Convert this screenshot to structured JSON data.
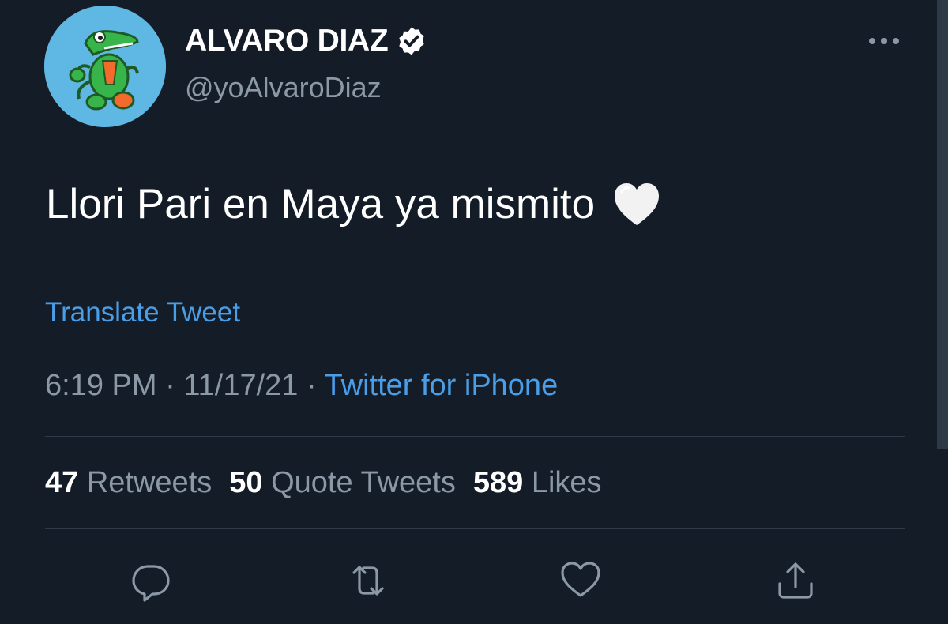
{
  "user": {
    "display_name": "ALVARO DIAZ",
    "handle": "@yoAlvaroDiaz",
    "verified": true,
    "avatar_icon": "green-crocodile-avatar"
  },
  "tweet": {
    "text": "Llori Pari en Maya ya mismito",
    "emoji": "white-heart",
    "translate_label": "Translate Tweet",
    "time": "6:19 PM",
    "separator": " · ",
    "date": "11/17/21",
    "source": "Twitter for iPhone"
  },
  "stats": {
    "retweets_count": "47",
    "retweets_label": "Retweets",
    "quotes_count": "50",
    "quotes_label": "Quote Tweets",
    "likes_count": "589",
    "likes_label": "Likes"
  },
  "actions": [
    {
      "name": "reply",
      "icon": "reply-icon"
    },
    {
      "name": "retweet",
      "icon": "retweet-icon"
    },
    {
      "name": "like",
      "icon": "heart-icon"
    },
    {
      "name": "share",
      "icon": "share-icon"
    }
  ],
  "colors": {
    "background": "#141d27",
    "link": "#4a9ee8",
    "secondary_text": "#8b98a5",
    "primary_text": "#ffffff"
  }
}
